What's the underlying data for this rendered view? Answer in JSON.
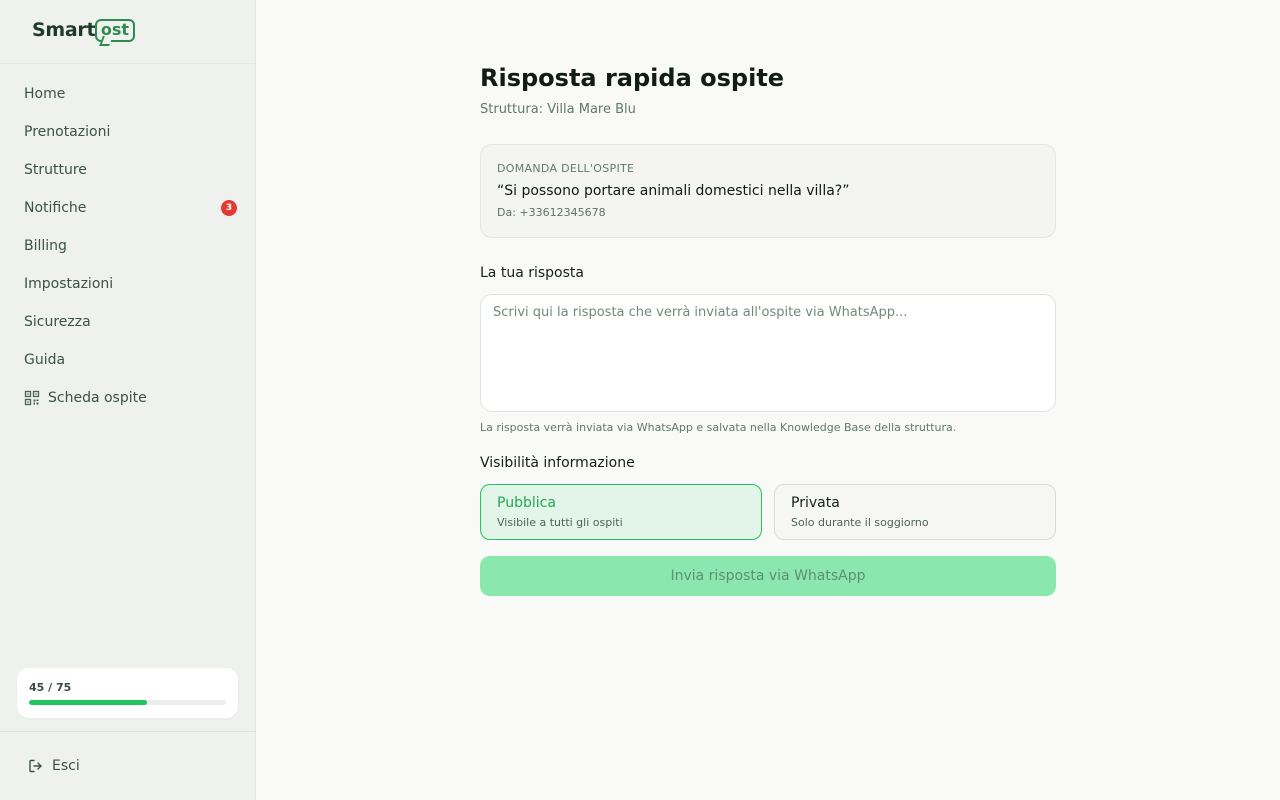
{
  "brand": {
    "name_prefix": "Smart",
    "name_badge": "ost",
    "accent": "#2e8b4e"
  },
  "sidebar": {
    "items": [
      {
        "label": "Home"
      },
      {
        "label": "Prenotazioni"
      },
      {
        "label": "Strutture"
      },
      {
        "label": "Notifiche",
        "badge": "3"
      },
      {
        "label": "Billing"
      },
      {
        "label": "Impostazioni"
      },
      {
        "label": "Sicurezza"
      },
      {
        "label": "Guida"
      },
      {
        "label": "Scheda ospite",
        "icon": "qr-code-icon"
      }
    ],
    "usage": {
      "text": "45 / 75",
      "used": 45,
      "total": 75,
      "bar_color": "#22c55e"
    },
    "logout": {
      "label": "Esci",
      "icon": "logout-icon"
    }
  },
  "main": {
    "title": "Risposta rapida ospite",
    "subtitle": "Struttura: Villa Mare Blu",
    "question": {
      "label": "DOMANDA DELL'OSPITE",
      "text": "“Si possono portare animali domestici nella villa?”",
      "from": "Da: +33612345678"
    },
    "reply": {
      "label": "La tua risposta",
      "value": "",
      "placeholder": "Scrivi qui la risposta che verrà inviata all'ospite via WhatsApp...",
      "hint": "La risposta verrà inviata via WhatsApp e salvata nella Knowledge Base della struttura."
    },
    "visibility": {
      "label": "Visibilità informazione",
      "selected": "Pubblica",
      "options": [
        {
          "title": "Pubblica",
          "description": "Visibile a tutti gli ospiti"
        },
        {
          "title": "Privata",
          "description": "Solo durante il soggiorno"
        }
      ]
    },
    "send_button": {
      "label": "Invia risposta via WhatsApp",
      "disabled": true
    }
  }
}
